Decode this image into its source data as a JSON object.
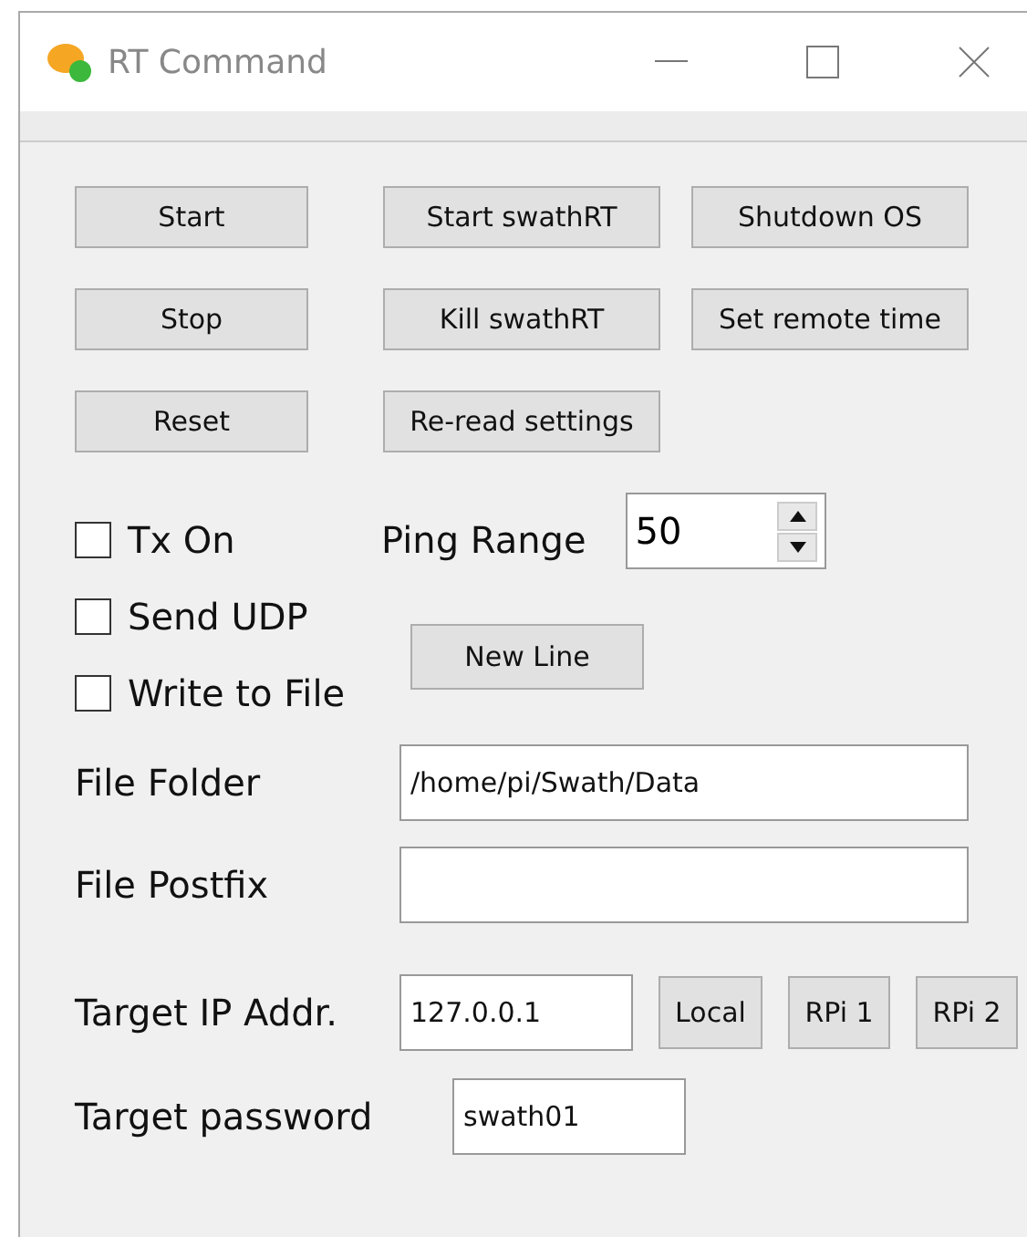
{
  "window": {
    "title": "RT Command"
  },
  "command_buttons": [
    [
      "Start",
      "Start swathRT",
      "Shutdown OS"
    ],
    [
      "Stop",
      "Kill swathRT",
      "Set remote time"
    ],
    [
      "Reset",
      "Re-read settings"
    ]
  ],
  "checkboxes": [
    {
      "label": "Tx On",
      "checked": false
    },
    {
      "label": "Send UDP",
      "checked": false
    },
    {
      "label": "Write to File",
      "checked": false
    }
  ],
  "ping_range": {
    "label": "Ping Range",
    "value": "50"
  },
  "new_line_button": "New Line",
  "file_fields": [
    {
      "label": "File Folder",
      "value": "/home/pi/Swath/Data"
    },
    {
      "label": "File Postfix"
    }
  ],
  "target_ip": {
    "label": "Target IP Addr.",
    "value": "127.0.0.1",
    "buttons": [
      "Local",
      "RPi 1",
      "RPi 2"
    ]
  },
  "target_password": {
    "label": "Target password",
    "value": "swath01"
  }
}
